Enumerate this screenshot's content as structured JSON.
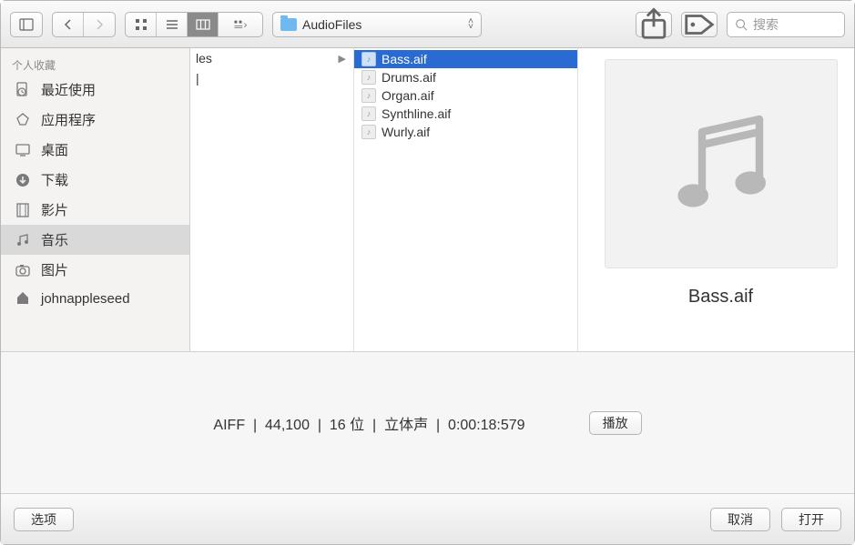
{
  "toolbar": {
    "path_label": "AudioFiles",
    "search_placeholder": "搜索"
  },
  "sidebar": {
    "header": "个人收藏",
    "items": [
      {
        "label": "最近使用",
        "icon": "clock-doc"
      },
      {
        "label": "应用程序",
        "icon": "apps"
      },
      {
        "label": "桌面",
        "icon": "desktop"
      },
      {
        "label": "下载",
        "icon": "download"
      },
      {
        "label": "影片",
        "icon": "film"
      },
      {
        "label": "音乐",
        "icon": "music",
        "selected": true
      },
      {
        "label": "图片",
        "icon": "camera"
      },
      {
        "label": "johnappleseed",
        "icon": "home"
      }
    ]
  },
  "column1": {
    "visible_tail": "les"
  },
  "column2_files": [
    {
      "name": "Bass.aif",
      "selected": true
    },
    {
      "name": "Drums.aif"
    },
    {
      "name": "Organ.aif"
    },
    {
      "name": "Synthline.aif"
    },
    {
      "name": "Wurly.aif"
    }
  ],
  "preview": {
    "filename": "Bass.aif"
  },
  "info": {
    "format": "AIFF",
    "sample_rate": "44,100",
    "bit_depth": "16 位",
    "channels": "立体声",
    "duration": "0:00:18:579",
    "play_label": "播放"
  },
  "bottom": {
    "options_label": "选项",
    "cancel_label": "取消",
    "open_label": "打开"
  }
}
